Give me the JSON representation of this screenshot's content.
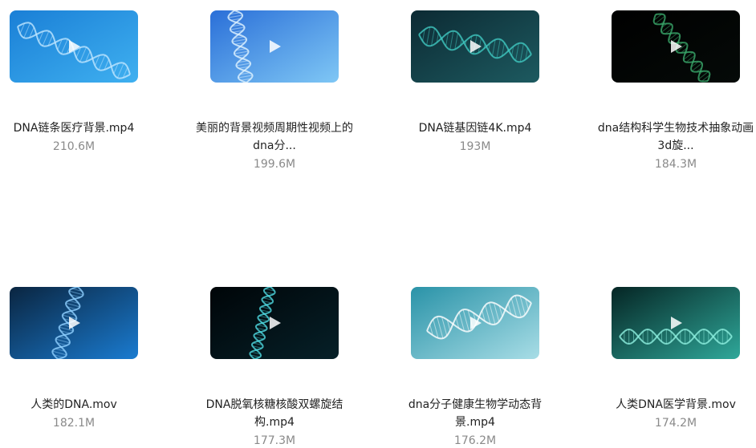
{
  "videos": [
    {
      "name": "DNA链条医疗背景.mp4",
      "size": "210.6M",
      "icon": "play-icon"
    },
    {
      "name": "美丽的背景视频周期性视频上的dna分...",
      "size": "199.6M",
      "icon": "play-icon"
    },
    {
      "name": "DNA链基因链4K.mp4",
      "size": "193M",
      "icon": "play-icon"
    },
    {
      "name": "dna结构科学生物技术抽象动画3d旋...",
      "size": "184.3M",
      "icon": "play-icon"
    },
    {
      "name": "人类的DNA.mov",
      "size": "182.1M",
      "icon": "play-icon"
    },
    {
      "name": "DNA脱氧核糖核酸双螺旋结构.mp4",
      "size": "177.3M",
      "icon": "play-icon"
    },
    {
      "name": "dna分子健康生物学动态背景.mp4",
      "size": "176.2M",
      "icon": "play-icon"
    },
    {
      "name": "人类DNA医学背景.mov",
      "size": "174.2M",
      "icon": "play-icon"
    }
  ],
  "colors": {
    "thumb_gradients": [
      [
        "#1a7fd6",
        "#3fb0f0"
      ],
      [
        "#2a6fd8",
        "#7fc7f5"
      ],
      [
        "#0c2a33",
        "#1d5a60"
      ],
      [
        "#000000",
        "#050a08"
      ],
      [
        "#0a2540",
        "#1a7bd0"
      ],
      [
        "#000508",
        "#062028"
      ],
      [
        "#2a93a8",
        "#a8dde6"
      ],
      [
        "#052524",
        "#2fa89a"
      ]
    ],
    "helix": [
      "#bfe6ff",
      "#dff3ff",
      "#40c8c0",
      "#3aa86a",
      "#8fd0ff",
      "#4fd8e0",
      "#ffffff",
      "#8ef0e0"
    ]
  }
}
